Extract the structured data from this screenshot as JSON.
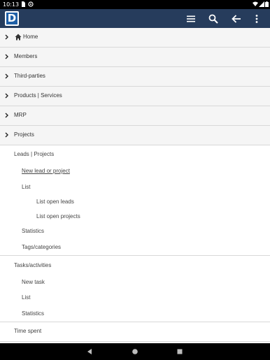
{
  "status_bar": {
    "time": "10:13"
  },
  "app": {
    "logo_letter": "D",
    "header_color": "#263c5c"
  },
  "toolbar": {
    "icons": [
      "menu-icon",
      "search-icon",
      "back-arrow-icon",
      "overflow-menu-icon"
    ]
  },
  "menu": {
    "home": "Home",
    "members": "Members",
    "third_parties": "Third-parties",
    "products_services": "Products | Services",
    "mrp": "MRP",
    "projects": "Projects"
  },
  "projects_sub": {
    "leads_projects": "Leads | Projects",
    "new_lead_or_project": "New lead or project",
    "list": "List",
    "list_open_leads": "List open leads",
    "list_open_projects": "List open projects",
    "statistics": "Statistics",
    "tags_categories": "Tags/categories"
  },
  "tasks_sub": {
    "tasks_activities": "Tasks/activities",
    "new_task": "New task",
    "list": "List",
    "statistics": "Statistics"
  },
  "time_spent": "Time spent"
}
